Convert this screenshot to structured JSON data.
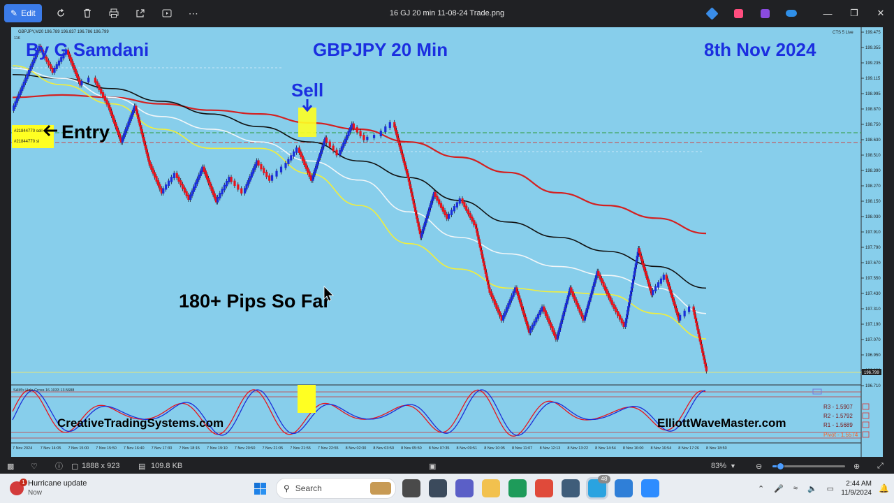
{
  "window": {
    "title": "16 GJ 20 min 11-08-24 Trade.png",
    "edit_label": "Edit"
  },
  "toolbar_icons": [
    "rotate-icon",
    "delete-icon",
    "print-icon",
    "share-icon",
    "slideshow-icon",
    "more-icon"
  ],
  "chart": {
    "symbol_header": "GBPJPY,M20  196.789 196.837 196.786 196.799",
    "header_sub": "116",
    "top_right_label": "CTS 5 Live",
    "author": "By G Samdani",
    "title": "GBPJPY 20 Min",
    "date": "8th Nov 2024",
    "sell_label": "Sell",
    "entry_label": "Entry",
    "pips_label": "180+ Pips So Far",
    "order_labels": [
      "#21844770 sell",
      "#21844770 sl"
    ],
    "current_price": "196.799",
    "price_ticks": [
      "199.475",
      "199.355",
      "199.235",
      "199.115",
      "198.995",
      "198.870",
      "198.750",
      "198.630",
      "198.510",
      "198.390",
      "198.270",
      "198.150",
      "198.030",
      "197.910",
      "197.790",
      "197.670",
      "197.550",
      "197.430",
      "197.310",
      "197.190",
      "197.070",
      "196.950",
      "196.830",
      "196.710"
    ],
    "oscillator_label": "SAM's Halo Cross 16.1033 13.5688",
    "pivot_levels": [
      {
        "label": "R3 - 1.5907",
        "color": "#7a1010"
      },
      {
        "label": "R2 - 1.5792",
        "color": "#7a1010"
      },
      {
        "label": "R1 - 1.5689",
        "color": "#7a1010"
      },
      {
        "label": "Pivot - 1.5574",
        "color": "#ff5a1a"
      }
    ],
    "site_left": "CreativeTradingSystems.com",
    "site_right": "ElliottWaveMaster.com",
    "time_ticks": [
      "7 Nov 2024",
      "7 Nov 14:05",
      "7 Nov 15:00",
      "7 Nov 15:50",
      "7 Nov 16:40",
      "7 Nov 17:30",
      "7 Nov 18:15",
      "7 Nov 19:10",
      "7 Nov 20:50",
      "7 Nov 21:05",
      "7 Nov 21:55",
      "7 Nov 22:55",
      "8 Nov 02:30",
      "8 Nov 03:50",
      "8 Nov 05:50",
      "8 Nov 07:35",
      "8 Nov 09:51",
      "8 Nov 10:05",
      "8 Nov 11:07",
      "8 Nov 12:13",
      "8 Nov 13:22",
      "8 Nov 14:54",
      "8 Nov 16:00",
      "8 Nov 16:54",
      "8 Nov 17:26",
      "8 Nov 18:50"
    ],
    "colors": {
      "background": "#87ceeb",
      "bear": "#e8141c",
      "bull": "#1a2ed8",
      "ma_red": "#d42020",
      "ma_black": "#111111",
      "ma_white": "#f2f6f8",
      "ma_yellow": "#f2ef3a",
      "highlight": "#ffff22"
    }
  },
  "chart_data": {
    "type": "candlestick",
    "title": "GBPJPY 20 Min",
    "xlabel": "",
    "ylabel": "",
    "ylim": [
      196.71,
      199.475
    ],
    "close_path": [
      198.85,
      199.1,
      199.35,
      199.15,
      199.32,
      199.05,
      199.1,
      198.9,
      198.6,
      198.88,
      198.45,
      198.2,
      198.35,
      198.15,
      198.4,
      198.13,
      198.32,
      198.2,
      198.45,
      198.3,
      198.4,
      198.55,
      198.3,
      198.63,
      198.5,
      198.74,
      198.62,
      198.65,
      198.75,
      198.35,
      197.85,
      198.2,
      198.0,
      198.15,
      197.95,
      197.45,
      197.2,
      197.45,
      197.1,
      197.3,
      197.05,
      197.45,
      197.2,
      197.58,
      197.35,
      197.15,
      197.76,
      197.4,
      197.55,
      197.2,
      197.3,
      196.8
    ],
    "series": [
      {
        "name": "",
        "color": "red",
        "values": [
          198.95,
          198.97,
          198.95,
          198.9,
          198.85,
          198.82,
          198.75,
          198.7,
          198.6,
          198.48,
          198.36,
          198.2,
          198.1,
          198.0,
          197.88
        ]
      },
      {
        "name": "",
        "color": "black",
        "values": [
          199.13,
          199.1,
          199.02,
          198.92,
          198.82,
          198.72,
          198.6,
          198.45,
          198.32,
          198.14,
          197.97,
          197.85,
          197.74,
          197.62,
          197.45
        ]
      },
      {
        "name": "",
        "color": "white",
        "values": [
          199.18,
          199.1,
          198.95,
          198.8,
          198.7,
          198.6,
          198.45,
          198.3,
          198.05,
          197.85,
          197.72,
          197.62,
          197.55,
          197.45,
          197.25
        ]
      },
      {
        "name": "",
        "color": "yellow",
        "values": [
          199.2,
          199.05,
          198.9,
          198.7,
          198.55,
          198.55,
          198.35,
          198.1,
          197.8,
          197.6,
          197.45,
          197.42,
          197.4,
          197.25,
          197.05
        ]
      }
    ],
    "current_price": 196.799,
    "annotations": [
      "Entry",
      "Sell",
      "180+ Pips So Far"
    ]
  },
  "status": {
    "dimensions": "1888 x 923",
    "file_size": "109.8 KB",
    "zoom": "83%",
    "zoom_fraction": 0.1
  },
  "taskbar": {
    "notification_title": "Hurricane update",
    "notification_sub": "Now",
    "notification_badge": "1",
    "search_placeholder": "Search",
    "apps": [
      {
        "name": "task-view",
        "color": "#4a4a4a"
      },
      {
        "name": "app-dark",
        "color": "#3b4a5c"
      },
      {
        "name": "teams",
        "color": "#5b5fc7"
      },
      {
        "name": "file-explorer",
        "color": "#f2c14e"
      },
      {
        "name": "excel-x",
        "color": "#1e9b5a"
      },
      {
        "name": "chrome",
        "color": "#e04a3a"
      },
      {
        "name": "app-mt4",
        "color": "#3f5d7a"
      },
      {
        "name": "telegram",
        "color": "#2aa3e0"
      },
      {
        "name": "photos",
        "color": "#2f7fd8"
      },
      {
        "name": "zoom",
        "color": "#2d8cff"
      }
    ],
    "telegram_badge": "48",
    "time": "2:44 AM",
    "date": "11/9/2024"
  }
}
